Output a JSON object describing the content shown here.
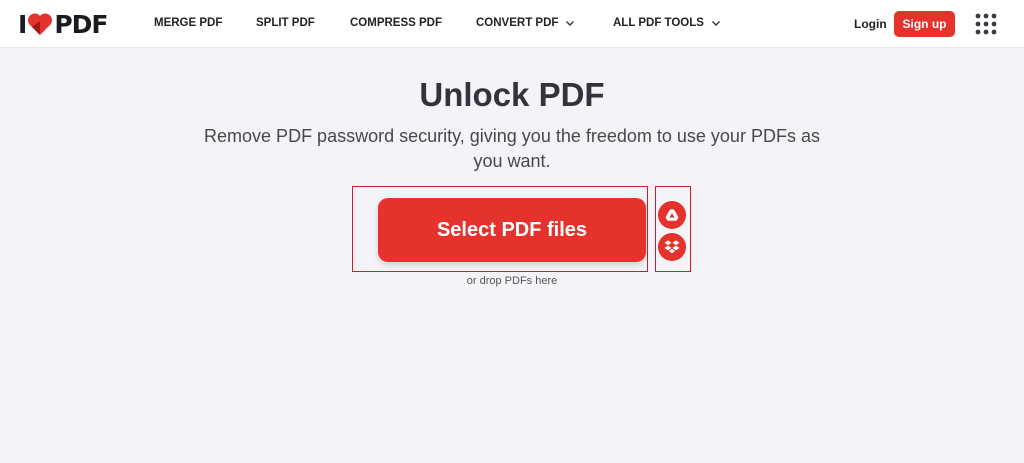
{
  "header": {
    "logo": {
      "left": "I",
      "right": "PDF"
    },
    "nav": [
      {
        "label": "MERGE PDF",
        "dropdown": false
      },
      {
        "label": "SPLIT PDF",
        "dropdown": false
      },
      {
        "label": "COMPRESS PDF",
        "dropdown": false
      },
      {
        "label": "CONVERT PDF",
        "dropdown": true
      },
      {
        "label": "ALL PDF TOOLS",
        "dropdown": true
      }
    ],
    "login_label": "Login",
    "signup_label": "Sign up",
    "apps_icon": "grid-icon"
  },
  "main": {
    "title": "Unlock PDF",
    "subtitle_line1": "Remove PDF password security, giving you the freedom to use your PDFs as",
    "subtitle_line2": "you want.",
    "select_button_label": "Select PDF files",
    "cloud_sources": [
      {
        "icon": "google-drive-icon"
      },
      {
        "icon": "dropbox-icon"
      }
    ],
    "drop_hint": "or drop PDFs here"
  },
  "colors": {
    "brand_red": "#e5322d",
    "background": "#f4f3f8",
    "highlight_border": "#d81b2a"
  }
}
